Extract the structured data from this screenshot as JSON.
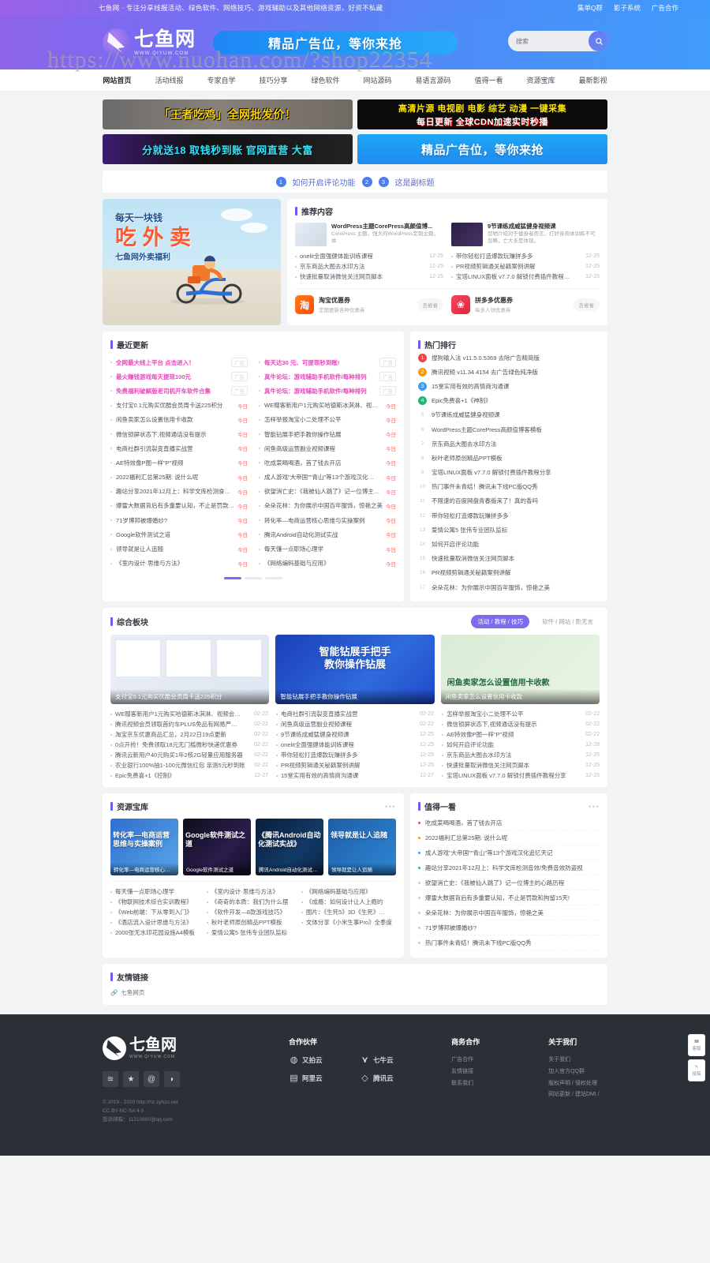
{
  "topbar": {
    "slogan": "七鱼网 · 专注分享线报活动、绿色软件、网络技巧、游戏辅助以及其他网络资源，好资不私藏",
    "links": [
      "集单Q群",
      "影子系统",
      "广告合作"
    ]
  },
  "header": {
    "logo_name": "七鱼网",
    "logo_domain": "WWW.QIYUW.COM",
    "ad_text": "精品广告位，等你来抢",
    "search_placeholder": "搜索",
    "watermark": "https://www.nuohan.com/?shop22354"
  },
  "nav": {
    "items": [
      "网站首页",
      "活动线报",
      "专家自学",
      "技巧分享",
      "绿色软件",
      "网站源码",
      "易语言源码",
      "值得一看",
      "资源宝库",
      "最新影视"
    ],
    "active_index": 0
  },
  "banners": [
    {
      "text": "「王者吃鸡」全网批发价！"
    },
    {
      "line1": "高清片源 电视剧 电影 综艺 动漫 一键采集",
      "line2": "每日更新  全球CDN加速实时秒播"
    },
    {
      "text": "分就送18 取钱秒到账 官网直营 大富"
    },
    {
      "text": "精品广告位，等你来抢"
    }
  ],
  "notice": {
    "badge1": "1",
    "title1": "如何开启评论功能",
    "badge2": "2",
    "badge3": "3",
    "title2": "这是副标题"
  },
  "slider": {
    "line1": "每天一块钱",
    "line2": "吃 外 卖",
    "line3": "七鱼网外卖福利"
  },
  "recommend": {
    "title": "推荐内容",
    "cards": [
      {
        "title": "WordPress主题CorePress高颜值博...",
        "desc": "CorePress 主题，强大的WordPress定制主题，体"
      },
      {
        "title": "9节课练成威猛健身视频课",
        "desc": "您稍介绍对于健身者而言，打好身肉体训练不可忽略，亡大永是体现。"
      }
    ],
    "list_left": [
      {
        "title": "onelit全面强健体能训练课程",
        "date": "12-25"
      },
      {
        "title": "京东商品大图去水印方法",
        "date": "12-25"
      },
      {
        "title": "快速批量取消微信关注网页脚本",
        "date": "12-25"
      }
    ],
    "list_right": [
      {
        "title": "带你轻松打造爆款玩赚拼多多",
        "date": "12-25"
      },
      {
        "title": "PR视频剪辑通关秘籍案例讲解",
        "date": "12-25"
      },
      {
        "title": "宝塔LINUX面板 v7.7.0 解锁付费插件教程…",
        "date": "12-25"
      }
    ],
    "coupons": [
      {
        "name": "淘宝优惠券",
        "sub": "定期更新各种优惠券",
        "btn": "去省省",
        "icon": "taobao-icon"
      },
      {
        "name": "拼多多优惠券",
        "sub": "每多人领优惠券",
        "btn": "去省省",
        "icon": "pdd-icon"
      }
    ]
  },
  "updates": {
    "title": "最近更新",
    "left": [
      {
        "title": "全网最大线上平台 点击进入！",
        "tag": "广告",
        "ad": true
      },
      {
        "title": "最火赚钱游戏每天提现100元",
        "tag": "广告",
        "ad": true
      },
      {
        "title": "免费福利破解版老司机开车软件合集",
        "tag": "广告",
        "ad": true
      },
      {
        "title": "支付宝0.1元购买优酷会员周卡送225积分",
        "tag": "今日"
      },
      {
        "title": "闲鱼卖家怎么设置信用卡收款",
        "tag": "今日"
      },
      {
        "title": "微信锁屏状态下,视频通话没有提示",
        "tag": "今日"
      },
      {
        "title": "电商社群引流裂变直播实战营",
        "tag": "今日"
      },
      {
        "title": "AE特效像P图一样\"P\"视频",
        "tag": "今日"
      },
      {
        "title": "2022福利汇总第25期: 说什么呢",
        "tag": "今日"
      },
      {
        "title": "趣站分享2021年12月上：科学文库检测食…",
        "tag": "今日"
      },
      {
        "title": "爆雷大数据背后有多重要认知，不止是罚款…",
        "tag": "今日"
      },
      {
        "title": "71岁博邦被爆婚纱?",
        "tag": "今日"
      },
      {
        "title": "Google软件测试之道",
        "tag": "今日"
      },
      {
        "title": "领导就是让人追随",
        "tag": "今日"
      },
      {
        "title": "《室内设计·思维与方法》",
        "tag": "今日"
      }
    ],
    "right": [
      {
        "title": "每天达30 元、可提现秒到账!",
        "tag": "广告",
        "ad": true
      },
      {
        "title": "真牛论坛：游戏辅助手机软件/每种排列",
        "tag": "广告",
        "ad": true
      },
      {
        "title": "真牛论坛：游戏辅助手机软件/每种排列",
        "tag": "广告",
        "ad": true
      },
      {
        "title": "WE赠客新用户1元购买哈德斯冰淇淋、视…",
        "tag": "今日"
      },
      {
        "title": "怎样举报淘宝小二处理不公平",
        "tag": "今日"
      },
      {
        "title": "智能钻展手把手教你操作钻展",
        "tag": "今日"
      },
      {
        "title": "闲鱼高级运营副业视频课程",
        "tag": "今日"
      },
      {
        "title": "吃成菜喝喝酒，首了钱去开店",
        "tag": "今日"
      },
      {
        "title": "成人游戏\"大帝国\"\"青山\"等13个游戏汉化…",
        "tag": "今日"
      },
      {
        "title": "欲望消亡史：《我被仙人跳了》记一位博主…",
        "tag": "今日"
      },
      {
        "title": "朵朵花林：为你展示中国百年服饰，惊艳之美",
        "tag": "今日"
      },
      {
        "title": "转化率—电商运营核心思维与实操案例",
        "tag": "今日"
      },
      {
        "title": "腾讯Android自动化测试实战",
        "tag": "今日"
      },
      {
        "title": "每天懂一点职场心理学",
        "tag": "今日"
      },
      {
        "title": "《网络编码基础与应用》",
        "tag": "今日"
      }
    ]
  },
  "ranking": {
    "title": "热门排行",
    "items": [
      {
        "n": "1",
        "title": "搜狗输入法 v11.5.0.5369 去除广告精简版"
      },
      {
        "n": "2",
        "title": "腾讯视频 v11.34.4154 去广告绿色纯净版"
      },
      {
        "n": "3",
        "title": "15堂实用有效的高情商沟通课"
      },
      {
        "n": "4",
        "title": "Epic免费喜+1《神制》"
      },
      {
        "n": "5",
        "title": "9节课练成威猛健身视频课"
      },
      {
        "n": "6",
        "title": "WordPress主题CorePress高颜值博客模板"
      },
      {
        "n": "7",
        "title": "京东商品大图去水印方法"
      },
      {
        "n": "8",
        "title": "秋叶老师原创精品PPT模板"
      },
      {
        "n": "9",
        "title": "宝塔LINUX面板 v7.7.0 解锁付费插件教程分享"
      },
      {
        "n": "10",
        "title": "热门事件未青结！腾讯未下线PC版QQ秀"
      },
      {
        "n": "11",
        "title": "不限速的百度网盘青春版来了！真的香吗"
      },
      {
        "n": "12",
        "title": "带你轻松打造爆款玩赚拼多多"
      },
      {
        "n": "13",
        "title": "爱情公寓5 张伟专业团队监标"
      },
      {
        "n": "14",
        "title": "如何开启评论功能"
      },
      {
        "n": "15",
        "title": "快速批量取消微信关注网页脚本"
      },
      {
        "n": "16",
        "title": "PR视频剪辑通关秘籍案例讲解"
      },
      {
        "n": "17",
        "title": "朵朵花林：为你展示中国百年服饰，惊艳之美"
      }
    ]
  },
  "combined": {
    "title": "综合板块",
    "tabs": [
      {
        "label": "活动 / 教程 / 技巧",
        "active": true
      },
      {
        "label": "软件 / 网站 / 影无言",
        "active": false
      }
    ],
    "cards": [
      {
        "caption": "支付宝0.1元购买优酷会员周卡送225积分",
        "mid": ""
      },
      {
        "caption": "智能钻展手把手教你操作钻展",
        "mid": "智能钻展手把手\n教你操作钻展"
      },
      {
        "caption": "闲鱼卖家怎么设置信用卡收款",
        "mid": "闲鱼卖家怎么设置信用卡收款"
      }
    ],
    "col1": [
      {
        "title": "WE赠客新用户1元购买哈德斯冰淇淋、视频会…",
        "date": "02-22"
      },
      {
        "title": "腾讯视频会员领取首约车PLUS免品有网易严…",
        "date": "02-22"
      },
      {
        "title": "淘宝京东优惠商品汇总，2月22日19点更新",
        "date": "02-22"
      },
      {
        "title": "0点开抢！免费领取18元无门槛微秒快递优惠券",
        "date": "02-22"
      },
      {
        "title": "腾讯云新用户40元购买1年2核2G轻量应用服务器",
        "date": "02-22"
      },
      {
        "title": "农业银行100%抽1-100元微信红包 亲测5元秒到账",
        "date": "02-22"
      },
      {
        "title": "Epic免费喜+1《控制》",
        "date": "12-27"
      }
    ],
    "col2": [
      {
        "title": "电商社群引流裂变直播实战营",
        "date": "02-22"
      },
      {
        "title": "闲鱼高级运营副业视频课程",
        "date": "02-22"
      },
      {
        "title": "9节课练成威猛健身视频课",
        "date": "12-25"
      },
      {
        "title": "onelit全面强健体能训练课程",
        "date": "12-25"
      },
      {
        "title": "带你轻松打造爆款玩赚拼多多",
        "date": "12-25"
      },
      {
        "title": "PR视频剪辑通关秘籍案例讲解",
        "date": "12-25"
      },
      {
        "title": "15堂实用有效的高情商沟通课",
        "date": "12-27"
      }
    ],
    "col3": [
      {
        "title": "怎样举报淘宝小二处理不公平",
        "date": "02-22"
      },
      {
        "title": "微信锁屏状态下,视频通话没有提示",
        "date": "02-22"
      },
      {
        "title": "AE特效像P图一样\"P\"视频",
        "date": "02-22"
      },
      {
        "title": "如何开启评论功能",
        "date": "12-28"
      },
      {
        "title": "京东商品大图去水印方法",
        "date": "12-25"
      },
      {
        "title": "快速批量取消微信关注网页脚本",
        "date": "12-25"
      },
      {
        "title": "宝塔LINUX面板 v7.7.0 解锁付费插件教程分享",
        "date": "12-25"
      }
    ]
  },
  "resources": {
    "title": "资源宝库",
    "more": "•••",
    "cards": [
      {
        "big": "转化率—电商运营思维与实操案例",
        "cap": "转化率—电商运营核心…"
      },
      {
        "big": "Google软件测试之道",
        "cap": "Google软件测试之道"
      },
      {
        "big": "《腾讯Android自动化测试实战》",
        "cap": "腾讯Android自动化测试…"
      },
      {
        "big": "领导就是让人追随",
        "cap": "领导就是让人追随"
      }
    ],
    "col1": [
      "每天懂一点职场心理学",
      "《物联网技术综合实训教程》",
      "《Web前端：下从零到入门》",
      "《酒店流入设计思维与方法》",
      "2000张无水印花园设施A4模板"
    ],
    "col2": [
      "《室内设计·思维与方法》",
      "《奇奇的本质：我们为什么摆",
      "《软件开发—8款游戏技巧》",
      "秋叶老师原创精品PPT模板",
      "爱情公寓5 张伟专业团队监标"
    ],
    "col3": [
      "《网络编码基础与应用》",
      "《成瘾：如何设计让人上瘾的",
      "图片：《生死5》3D《生死》…",
      "文体分享《小米生事Pro》全季度"
    ]
  },
  "worth": {
    "title": "值得一看",
    "more": "•••",
    "items": [
      {
        "title": "吃成菜喝喝酒，首了钱去开店",
        "color": "#ef4444"
      },
      {
        "title": "2022福利汇总第25期: 说什么呢",
        "color": "#f59e0b"
      },
      {
        "title": "成人游戏\"大帝国\"\"青山\"等13个游戏汉化追忆天记",
        "color": "#3b9cf5"
      },
      {
        "title": "趣站分享2021年12月上：科学文库检测音效/免费音效防盗视",
        "color": "#22b573"
      },
      {
        "title": "欲望消亡史：《我被仙人跳了》记一位博主的心路历程",
        "color": "#c9ccd2"
      },
      {
        "title": "爆雷大数据背后有多重要认知，不止是罚款和拘留15天!",
        "color": "#c9ccd2"
      },
      {
        "title": "朵朵花林：为你展示中国百年服饰，惊艳之美",
        "color": "#c9ccd2"
      },
      {
        "title": "71岁博邦被爆婚纱?",
        "color": "#c9ccd2"
      },
      {
        "title": "热门事件未青结！腾讯未下线PC版QQ秀",
        "color": "#c9ccd2"
      }
    ]
  },
  "friend_links": {
    "title": "友情链接",
    "items": [
      "七鱼网页"
    ]
  },
  "floaters": [
    {
      "label": "客服",
      "icon": "customer-service-icon"
    },
    {
      "label": "投稿",
      "icon": "submit-icon"
    }
  ],
  "footer": {
    "logo_name": "七鱼网",
    "logo_domain": "WWW.QIYUW.COM",
    "socials": [
      "rss-icon",
      "star-icon",
      "weibo-icon",
      "wechat-icon"
    ],
    "copyright": "© 2019 - 2020 http://hz.zyhzo.net\nCC BY-NC-SA 4.0\n投诉邮箱：11210900@qq.com",
    "partners_title": "合作伙伴",
    "partners": [
      {
        "name": "又拍云",
        "icon": "upyun-icon"
      },
      {
        "name": "七牛云",
        "icon": "qiniu-icon"
      },
      {
        "name": "阿里云",
        "icon": "aliyun-icon"
      },
      {
        "name": "腾讯云",
        "icon": "tencentcloud-icon"
      }
    ],
    "business_title": "商务合作",
    "business": [
      "广告合作",
      "友情链接",
      "联系我们"
    ],
    "about_title": "关于我们",
    "about": [
      "关于我们",
      "加入官方QQ群",
      "版权声明 / 侵权处理",
      "网站更新 / 建站DMI /"
    ]
  }
}
